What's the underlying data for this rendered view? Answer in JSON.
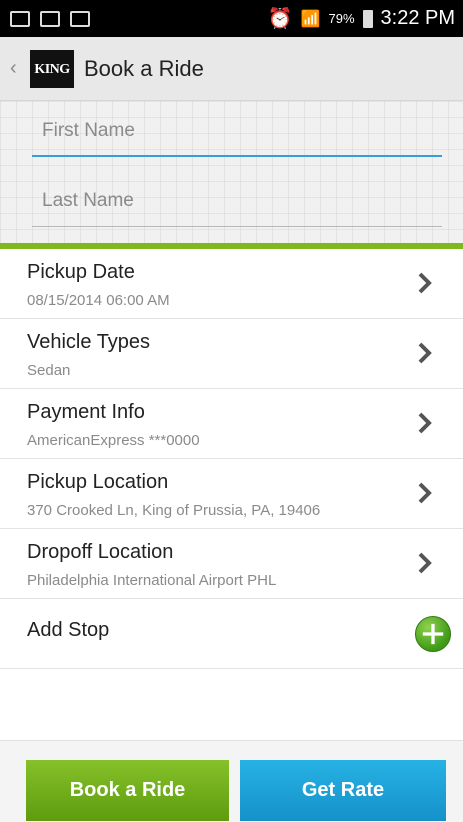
{
  "status": {
    "battery": "79%",
    "time": "3:22 PM"
  },
  "header": {
    "title": "Book a Ride",
    "logo_text": "KING"
  },
  "form": {
    "first_name_placeholder": "First Name",
    "last_name_placeholder": "Last Name"
  },
  "rows": [
    {
      "label": "Pickup Date",
      "value": "08/15/2014 06:00 AM"
    },
    {
      "label": "Vehicle Types",
      "value": "Sedan"
    },
    {
      "label": "Payment Info",
      "value": "AmericanExpress ***0000"
    },
    {
      "label": "Pickup Location",
      "value": "370 Crooked Ln, King of Prussia, PA, 19406"
    },
    {
      "label": "Dropoff Location",
      "value": "Philadelphia International Airport PHL"
    }
  ],
  "add_stop": {
    "label": "Add Stop"
  },
  "buttons": {
    "book": "Book a Ride",
    "rate": "Get Rate"
  },
  "colors": {
    "accent_green": "#7eb81d",
    "accent_blue": "#33a1d6"
  }
}
